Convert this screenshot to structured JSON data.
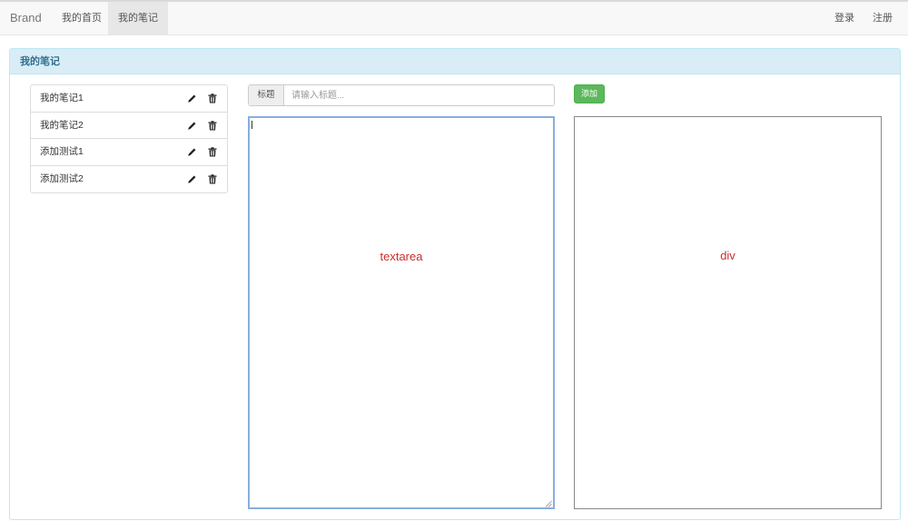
{
  "navbar": {
    "brand": "Brand",
    "items": [
      {
        "label": "我的首页",
        "active": false
      },
      {
        "label": "我的笔记",
        "active": true
      }
    ],
    "right_items": [
      {
        "label": "登录"
      },
      {
        "label": "注册"
      }
    ]
  },
  "panel": {
    "title": "我的笔记"
  },
  "notes": [
    {
      "title": "我的笔记1",
      "edit_icon": "pencil-icon",
      "delete_icon": "trash-icon"
    },
    {
      "title": "我的笔记2",
      "edit_icon": "pencil-icon",
      "delete_icon": "trash-icon"
    },
    {
      "title": "添加测试1",
      "edit_icon": "pencil-icon",
      "delete_icon": "trash-icon"
    },
    {
      "title": "添加测试2",
      "edit_icon": "pencil-icon",
      "delete_icon": "trash-icon"
    }
  ],
  "editor": {
    "title_addon": "标题",
    "title_placeholder": "请输入标题...",
    "title_value": "",
    "add_button": "添加",
    "textarea_label": "textarea",
    "preview_label": "div"
  },
  "colors": {
    "panel_heading_bg": "#d9edf7",
    "panel_heading_text": "#31708f",
    "add_button": "#5cb85c",
    "label_red": "#c9302c",
    "editor_focus_border": "#87aee0"
  }
}
